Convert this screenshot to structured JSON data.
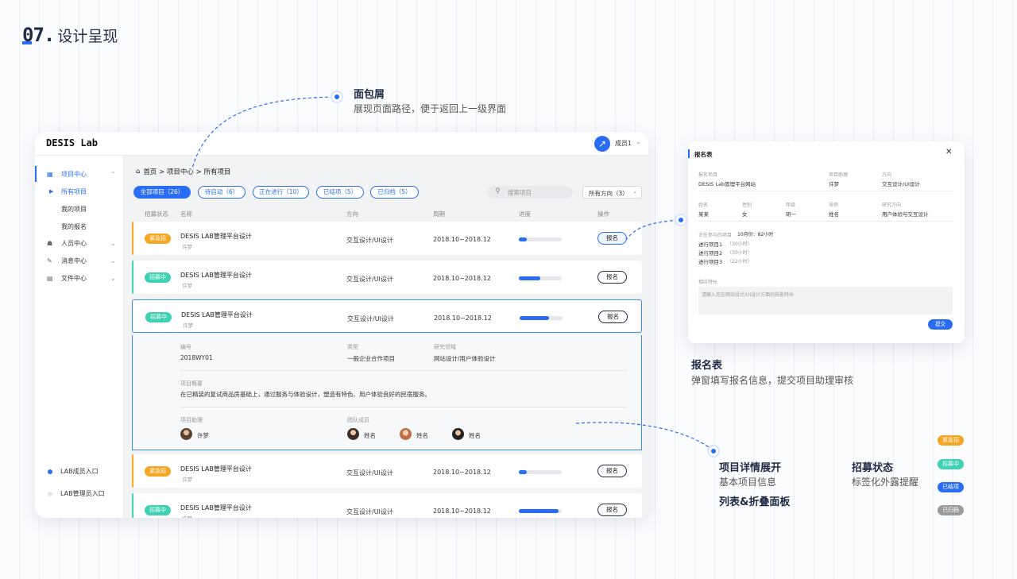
{
  "heading": {
    "number": "07.",
    "title": "设计呈现"
  },
  "app": {
    "logo": "DESIS Lab",
    "user": {
      "name": "成员1",
      "caret": "⌄"
    },
    "sidebar": {
      "items": [
        {
          "label": "项目中心",
          "icon": "▦",
          "chevron": "⌃"
        },
        {
          "label": "人员中心",
          "icon": "☗",
          "chevron": "⌄"
        },
        {
          "label": "消息中心",
          "icon": "✎",
          "chevron": "⌄"
        },
        {
          "label": "文件中心",
          "icon": "▤",
          "chevron": "⌄"
        }
      ],
      "sub_items": [
        "所有项目",
        "我的项目",
        "我的报名"
      ],
      "entries": [
        "LAB成员入口",
        "LAB管理员入口"
      ]
    },
    "breadcrumb": {
      "home_icon": "⌂",
      "text": "首页 > 项目中心 > 所有项目"
    },
    "filters": [
      "全部项目（26）",
      "待启动（6）",
      "正在进行（10）",
      "已结项（5）",
      "已归档（5）"
    ],
    "search": {
      "placeholder": "搜索项目",
      "icon": "⚲"
    },
    "direction_select": {
      "value": "所有方向（3）",
      "caret": "⌄"
    },
    "table": {
      "headers": [
        "招募状态",
        "名称",
        "方向",
        "周期",
        "进度",
        "操作"
      ],
      "rows": [
        {
          "status": "紧急招",
          "status_color": "#f5a623",
          "name": "DESIS LAB管理平台设计",
          "owner": "许梦",
          "direction": "交互设计/UI设计",
          "period": "2018.10~2018.12",
          "progress": 0.18,
          "action": "报名"
        },
        {
          "status": "招募中",
          "status_color": "#3fd1b3",
          "name": "DESIS LAB管理平台设计",
          "owner": "许梦",
          "direction": "交互设计/UI设计",
          "period": "2018.10~2018.12",
          "progress": 0.5,
          "action": "报名"
        },
        {
          "status": "招募中",
          "status_color": "#3fd1b3",
          "name": "DESIS LAB管理平台设计",
          "owner": "许梦",
          "direction": "交互设计/UI设计",
          "period": "2018.10~2018.12",
          "progress": 0.68,
          "action": "报名"
        },
        {
          "status": "紧急招",
          "status_color": "#f5a623",
          "name": "DESIS LAB管理平台设计",
          "owner": "许梦",
          "direction": "交互设计/UI设计",
          "period": "2018.10~2018.12",
          "progress": 0.18,
          "action": "报名"
        },
        {
          "status": "招募中",
          "status_color": "#3fd1b3",
          "name": "DESIS LAB管理平台设计",
          "owner": "许梦",
          "direction": "交互设计/UI设计",
          "period": "2018.10~2018.12",
          "progress": 0.92,
          "action": "报名"
        }
      ]
    },
    "detail": {
      "code_label": "编号",
      "code": "2018WY01",
      "type_label": "类型",
      "type": "一般企业合作项目",
      "field_label": "研究领域",
      "field": "网站设计/用户体验设计",
      "summary_label": "项目概要",
      "summary": "在已精装的复试商品房基础上，通过服务与体验设计，塑造有特色、用户体验良好的民宿服务。",
      "assistant_label": "项目助理",
      "assistant": "许梦",
      "team_label": "团队成员",
      "team": [
        "姓名",
        "姓名",
        "姓名"
      ]
    }
  },
  "dialog": {
    "title": "报名表",
    "close": "✕",
    "project_label": "报名项目",
    "project": "DESIS Lab管理平台网站",
    "assistant_label": "项目助理",
    "assistant": "许梦",
    "direction_label": "方向",
    "direction": "交互设计/UI设计",
    "name_label": "姓名",
    "name": "某某",
    "gender_label": "性别",
    "gender": "女",
    "grade_label": "年级",
    "grade": "研一",
    "mentor_label": "导师",
    "mentor": "姓名",
    "research_label": "研究方向",
    "research": "用户体验与交互设计",
    "ongoing_label": "正在参与的项目",
    "ongoing_summary": "10月份：82小时",
    "ongoing": [
      {
        "name": "进行项目1",
        "hours": "（30小时）"
      },
      {
        "name": "进行项目2",
        "hours": "（30小时）"
      },
      {
        "name": "进行项目3",
        "hours": "（22小时）"
      }
    ],
    "skills_label": "相应特长",
    "skills_placeholder": "请输入您在网站设计/UI设计方面的技能特长",
    "submit": "提交"
  },
  "annotations": {
    "breadcrumb": {
      "title": "面包屑",
      "subtitle": "展现页面路径，便于返回上一级界面"
    },
    "form": {
      "title": "报名表",
      "subtitle": "弹窗填写报名信息，提交项目助理审核"
    },
    "detail": {
      "title": "项目详情展开",
      "subtitle": "基本项目信息",
      "title2": "列表&折叠面板"
    },
    "status": {
      "title": "招募状态",
      "subtitle": "标签化外露提醒"
    },
    "legend": [
      {
        "label": "紧急招",
        "color": "#f5a623"
      },
      {
        "label": "招募中",
        "color": "#3fd1b3"
      },
      {
        "label": "已结项",
        "color": "#2a6df5"
      },
      {
        "label": "已归档",
        "color": "#9b9b9b"
      }
    ]
  },
  "colors": {
    "accent": "#2a6df5",
    "urgent": "#f5a623",
    "recruiting": "#3fd1b3",
    "archived": "#9b9b9b"
  }
}
